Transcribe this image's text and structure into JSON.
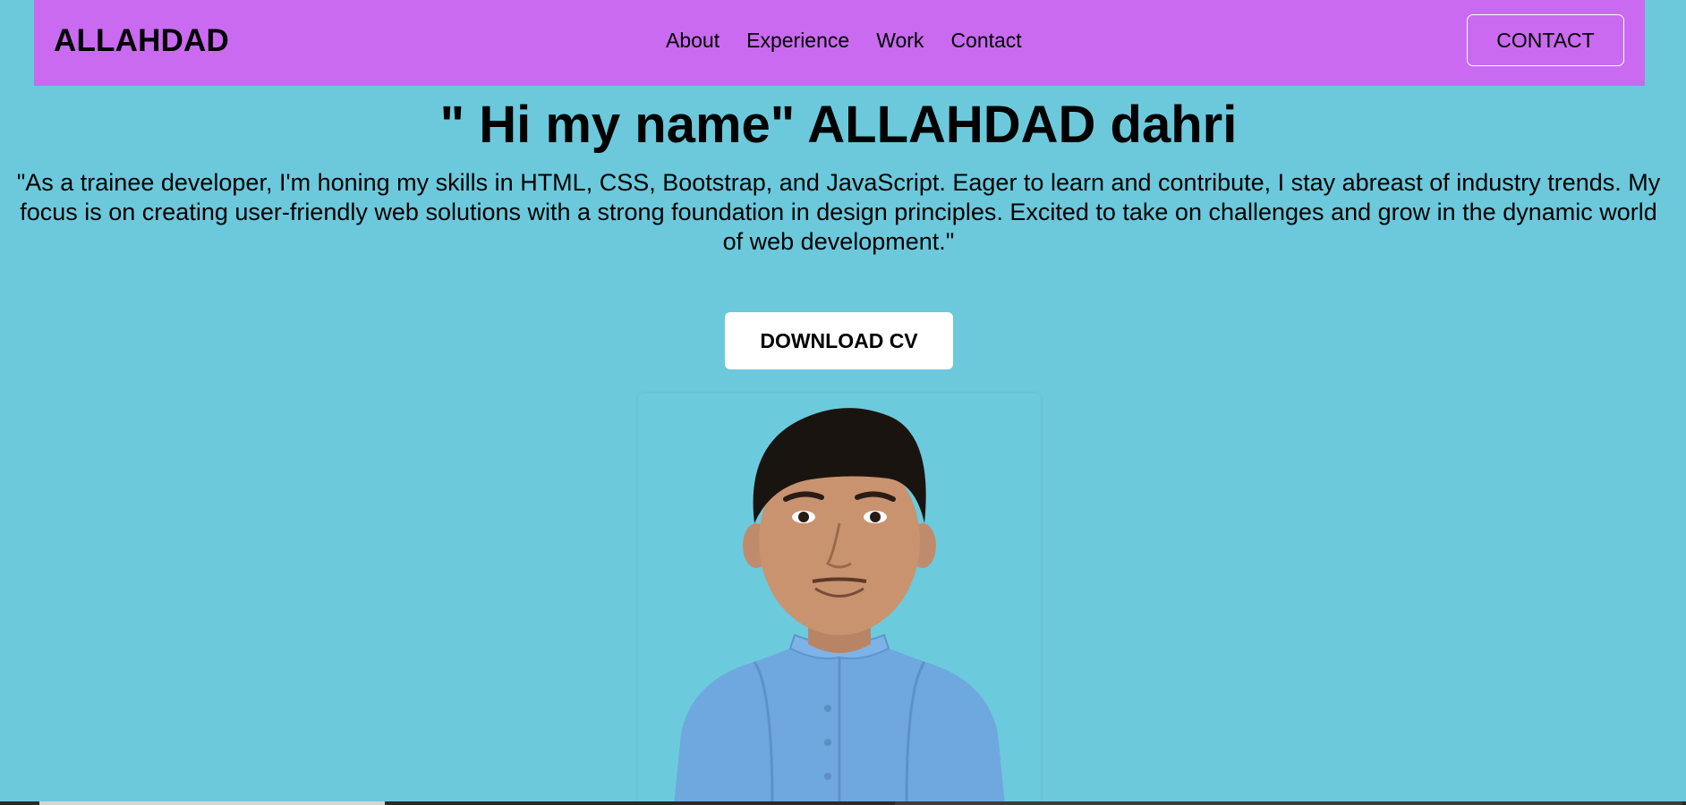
{
  "navbar": {
    "brand": "ALLAHDAD",
    "links": [
      "About",
      "Experience",
      "Work",
      "Contact"
    ],
    "contact_button": "CONTACT",
    "background_color": "#c96af0"
  },
  "hero": {
    "title": "\" Hi my name\" ALLAHDAD dahri",
    "description": "\"As a trainee developer, I'm honing my skills in HTML, CSS, Bootstrap, and JavaScript. Eager to learn and contribute, I stay abreast of industry trends. My focus is on creating user-friendly web solutions with a strong foundation in design principles. Excited to take on challenges and grow in the dynamic world of web development.\"",
    "download_button": "DOWNLOAD CV"
  },
  "colors": {
    "page_background": "#6cc9dc",
    "button_background": "#ffffff"
  },
  "photo": {
    "icon": "profile-photo"
  }
}
